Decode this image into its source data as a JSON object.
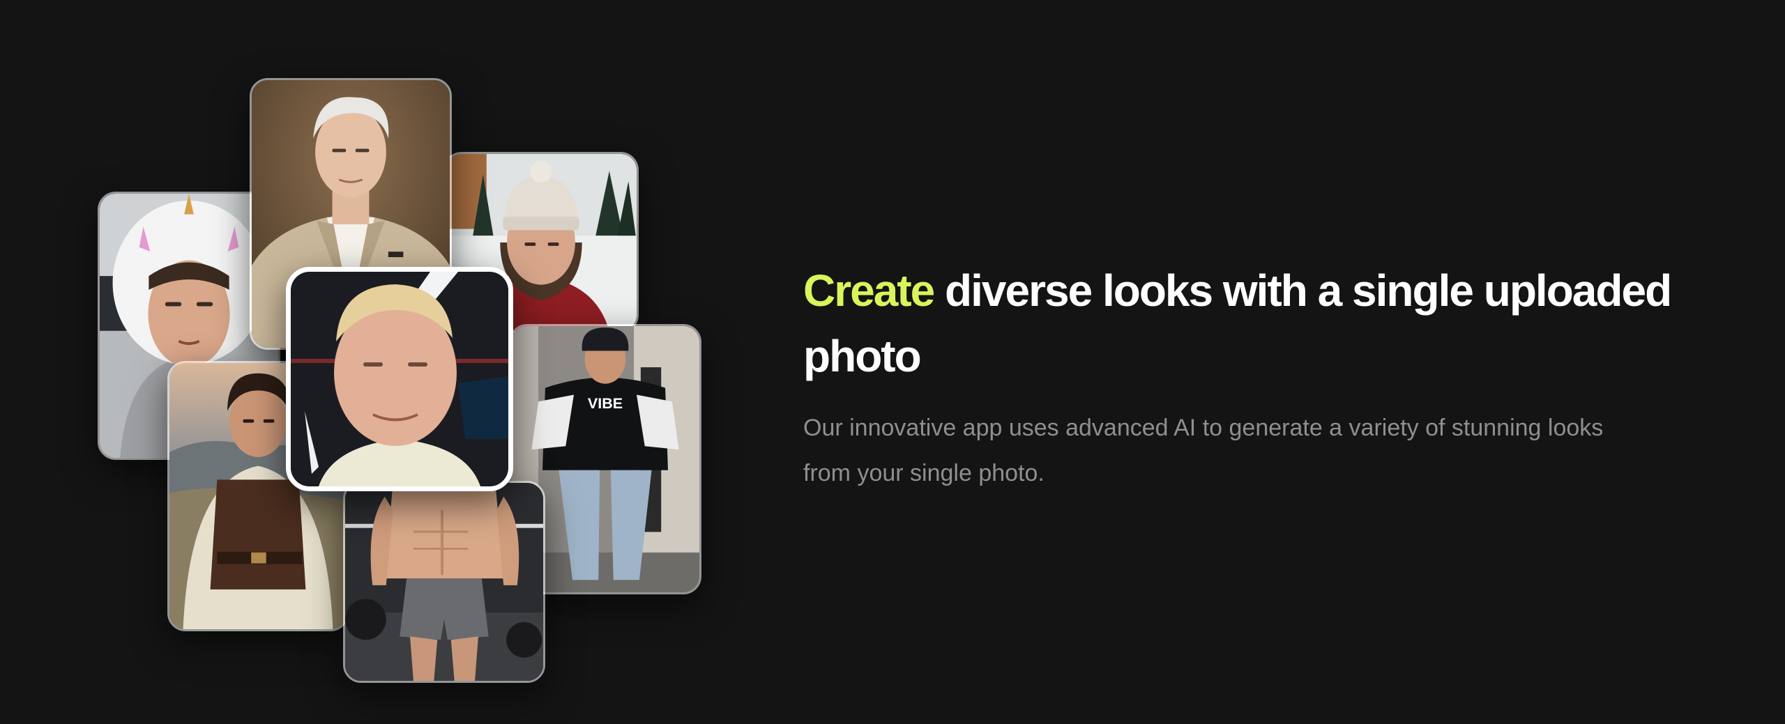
{
  "hero": {
    "headline_accent": "Create",
    "headline_rest": " diverse looks with a single uploaded photo",
    "description": "Our innovative app uses advanced AI to generate a variety of stunning looks from your single photo.",
    "colors": {
      "background": "#141414",
      "accent": "#d8f55a",
      "headline": "#ffffff",
      "description": "#8f8f8f"
    }
  },
  "collage": {
    "photos": [
      {
        "name": "unicorn-hoodie-photo"
      },
      {
        "name": "elder-gentleman-suit-photo"
      },
      {
        "name": "beanie-winter-photo"
      },
      {
        "name": "medieval-costume-photo"
      },
      {
        "name": "streetwear-photo"
      },
      {
        "name": "gym-physique-photo"
      },
      {
        "name": "original-selfie-photo"
      }
    ],
    "shirt_print": "VIBE"
  }
}
